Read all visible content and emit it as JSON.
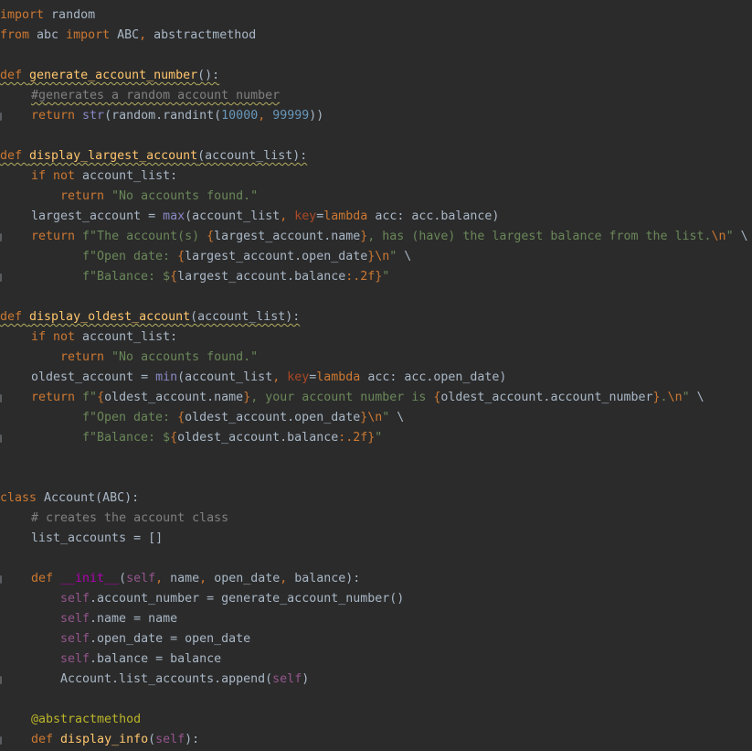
{
  "editor": {
    "language": "python",
    "colors": {
      "background": "#2b2b2b",
      "default": "#a9b7c6",
      "keyword": "#cc7832",
      "string": "#6a8759",
      "number": "#6897bb",
      "comment": "#808080",
      "function_def": "#ffc66d",
      "builtin": "#8888c6",
      "self": "#94558d",
      "param": "#aa4926",
      "decorator": "#bbb529",
      "magic_method": "#b200b2"
    },
    "lines": [
      {
        "indent": 0,
        "fold": false,
        "tokens": [
          [
            "keyword",
            "import"
          ],
          [
            "default",
            " random"
          ]
        ]
      },
      {
        "indent": 0,
        "fold": false,
        "tokens": [
          [
            "keyword",
            "from"
          ],
          [
            "default",
            " abc "
          ],
          [
            "keyword",
            "import"
          ],
          [
            "default",
            " ABC"
          ],
          [
            "keyword",
            ","
          ],
          [
            "default",
            " abstractmethod"
          ]
        ]
      },
      {
        "indent": 0,
        "fold": false,
        "tokens": []
      },
      {
        "indent": 0,
        "fold": false,
        "wavy": true,
        "tokens": [
          [
            "keyword",
            "def "
          ],
          [
            "funcdef",
            "generate_account_number"
          ],
          [
            "default",
            "():"
          ]
        ]
      },
      {
        "indent": 1,
        "fold": false,
        "wavy": true,
        "tokens": [
          [
            "comment",
            "#generates a random account number"
          ]
        ]
      },
      {
        "indent": 1,
        "fold": true,
        "tokens": [
          [
            "keyword",
            "return "
          ],
          [
            "builtin",
            "str"
          ],
          [
            "default",
            "(random.randint("
          ],
          [
            "number",
            "10000"
          ],
          [
            "keyword",
            ", "
          ],
          [
            "number",
            "99999"
          ],
          [
            "default",
            "))"
          ]
        ]
      },
      {
        "indent": 0,
        "fold": false,
        "tokens": []
      },
      {
        "indent": 0,
        "fold": false,
        "wavy": true,
        "tokens": [
          [
            "keyword",
            "def "
          ],
          [
            "funcdef",
            "display_largest_account"
          ],
          [
            "default",
            "(account_list):"
          ]
        ]
      },
      {
        "indent": 1,
        "fold": false,
        "tokens": [
          [
            "keyword",
            "if not "
          ],
          [
            "default",
            "account_list:"
          ]
        ]
      },
      {
        "indent": 2,
        "fold": false,
        "tokens": [
          [
            "keyword",
            "return "
          ],
          [
            "string",
            "\"No accounts found.\""
          ]
        ]
      },
      {
        "indent": 1,
        "fold": false,
        "tokens": [
          [
            "default",
            "largest_account = "
          ],
          [
            "builtin",
            "max"
          ],
          [
            "default",
            "(account_list"
          ],
          [
            "keyword",
            ", "
          ],
          [
            "param",
            "key"
          ],
          [
            "default",
            "="
          ],
          [
            "keyword",
            "lambda "
          ],
          [
            "default",
            "acc: acc.balance)"
          ]
        ]
      },
      {
        "indent": 1,
        "fold": true,
        "tokens": [
          [
            "keyword",
            "return "
          ],
          [
            "string",
            "f\"The account(s) "
          ],
          [
            "fmt",
            "{"
          ],
          [
            "default",
            "largest_account.name"
          ],
          [
            "fmt",
            "}"
          ],
          [
            "string",
            ", has (have) the largest balance from the list."
          ],
          [
            "escape",
            "\\n"
          ],
          [
            "string",
            "\""
          ],
          [
            "default",
            " \\"
          ]
        ]
      },
      {
        "indent": 3,
        "fold": false,
        "tokens": [
          [
            "string",
            "f\"Open date: "
          ],
          [
            "fmt",
            "{"
          ],
          [
            "default",
            "largest_account.open_date"
          ],
          [
            "fmt",
            "}"
          ],
          [
            "escape",
            "\\n"
          ],
          [
            "string",
            "\""
          ],
          [
            "default",
            " \\"
          ]
        ]
      },
      {
        "indent": 3,
        "fold": true,
        "tokens": [
          [
            "string",
            "f\"Balance: $"
          ],
          [
            "fmt",
            "{"
          ],
          [
            "default",
            "largest_account.balance"
          ],
          [
            "fmt",
            ":.2f}"
          ],
          [
            "string",
            "\""
          ]
        ]
      },
      {
        "indent": 0,
        "fold": false,
        "tokens": []
      },
      {
        "indent": 0,
        "fold": false,
        "wavy": true,
        "tokens": [
          [
            "keyword",
            "def "
          ],
          [
            "funcdef",
            "display_oldest_account"
          ],
          [
            "default",
            "(account_list):"
          ]
        ]
      },
      {
        "indent": 1,
        "fold": false,
        "tokens": [
          [
            "keyword",
            "if not "
          ],
          [
            "default",
            "account_list:"
          ]
        ]
      },
      {
        "indent": 2,
        "fold": false,
        "tokens": [
          [
            "keyword",
            "return "
          ],
          [
            "string",
            "\"No accounts found.\""
          ]
        ]
      },
      {
        "indent": 1,
        "fold": false,
        "tokens": [
          [
            "default",
            "oldest_account = "
          ],
          [
            "builtin",
            "min"
          ],
          [
            "default",
            "(account_list"
          ],
          [
            "keyword",
            ", "
          ],
          [
            "param",
            "key"
          ],
          [
            "default",
            "="
          ],
          [
            "keyword",
            "lambda "
          ],
          [
            "default",
            "acc: acc.open_date)"
          ]
        ]
      },
      {
        "indent": 1,
        "fold": true,
        "tokens": [
          [
            "keyword",
            "return "
          ],
          [
            "string",
            "f\""
          ],
          [
            "fmt",
            "{"
          ],
          [
            "default",
            "oldest_account.name"
          ],
          [
            "fmt",
            "}"
          ],
          [
            "string",
            ", your account number is "
          ],
          [
            "fmt",
            "{"
          ],
          [
            "default",
            "oldest_account.account_number"
          ],
          [
            "fmt",
            "}"
          ],
          [
            "string",
            "."
          ],
          [
            "escape",
            "\\n"
          ],
          [
            "string",
            "\""
          ],
          [
            "default",
            " \\"
          ]
        ]
      },
      {
        "indent": 3,
        "fold": false,
        "tokens": [
          [
            "string",
            "f\"Open date: "
          ],
          [
            "fmt",
            "{"
          ],
          [
            "default",
            "oldest_account.open_date"
          ],
          [
            "fmt",
            "}"
          ],
          [
            "escape",
            "\\n"
          ],
          [
            "string",
            "\""
          ],
          [
            "default",
            " \\"
          ]
        ]
      },
      {
        "indent": 3,
        "fold": true,
        "tokens": [
          [
            "string",
            "f\"Balance: $"
          ],
          [
            "fmt",
            "{"
          ],
          [
            "default",
            "oldest_account.balance"
          ],
          [
            "fmt",
            ":.2f}"
          ],
          [
            "string",
            "\""
          ]
        ]
      },
      {
        "indent": 0,
        "fold": false,
        "tokens": []
      },
      {
        "indent": 0,
        "fold": false,
        "tokens": []
      },
      {
        "indent": 0,
        "fold": false,
        "tokens": [
          [
            "keyword",
            "class "
          ],
          [
            "default",
            "Account(ABC):"
          ]
        ]
      },
      {
        "indent": 1,
        "fold": false,
        "tokens": [
          [
            "comment",
            "# creates the account class"
          ]
        ]
      },
      {
        "indent": 1,
        "fold": false,
        "tokens": [
          [
            "default",
            "list_accounts = []"
          ]
        ]
      },
      {
        "indent": 0,
        "fold": false,
        "tokens": []
      },
      {
        "indent": 1,
        "fold": true,
        "tokens": [
          [
            "keyword",
            "def "
          ],
          [
            "magic",
            "__init__"
          ],
          [
            "default",
            "("
          ],
          [
            "self",
            "self"
          ],
          [
            "keyword",
            ", "
          ],
          [
            "default",
            "name"
          ],
          [
            "keyword",
            ", "
          ],
          [
            "default",
            "open_date"
          ],
          [
            "keyword",
            ", "
          ],
          [
            "default",
            "balance):"
          ]
        ]
      },
      {
        "indent": 2,
        "fold": false,
        "tokens": [
          [
            "self",
            "self"
          ],
          [
            "default",
            ".account_number = generate_account_number()"
          ]
        ]
      },
      {
        "indent": 2,
        "fold": false,
        "tokens": [
          [
            "self",
            "self"
          ],
          [
            "default",
            ".name = name"
          ]
        ]
      },
      {
        "indent": 2,
        "fold": false,
        "tokens": [
          [
            "self",
            "self"
          ],
          [
            "default",
            ".open_date = open_date"
          ]
        ]
      },
      {
        "indent": 2,
        "fold": false,
        "tokens": [
          [
            "self",
            "self"
          ],
          [
            "default",
            ".balance = balance"
          ]
        ]
      },
      {
        "indent": 2,
        "fold": true,
        "tokens": [
          [
            "default",
            "Account.list_accounts.append("
          ],
          [
            "self",
            "self"
          ],
          [
            "default",
            ")"
          ]
        ]
      },
      {
        "indent": 0,
        "fold": false,
        "tokens": []
      },
      {
        "indent": 1,
        "fold": false,
        "tokens": [
          [
            "decorator",
            "@abstractmethod"
          ]
        ]
      },
      {
        "indent": 1,
        "fold": true,
        "tokens": [
          [
            "keyword",
            "def "
          ],
          [
            "funcdef",
            "display_info"
          ],
          [
            "default",
            "("
          ],
          [
            "self",
            "self"
          ],
          [
            "default",
            "):"
          ]
        ]
      }
    ]
  }
}
